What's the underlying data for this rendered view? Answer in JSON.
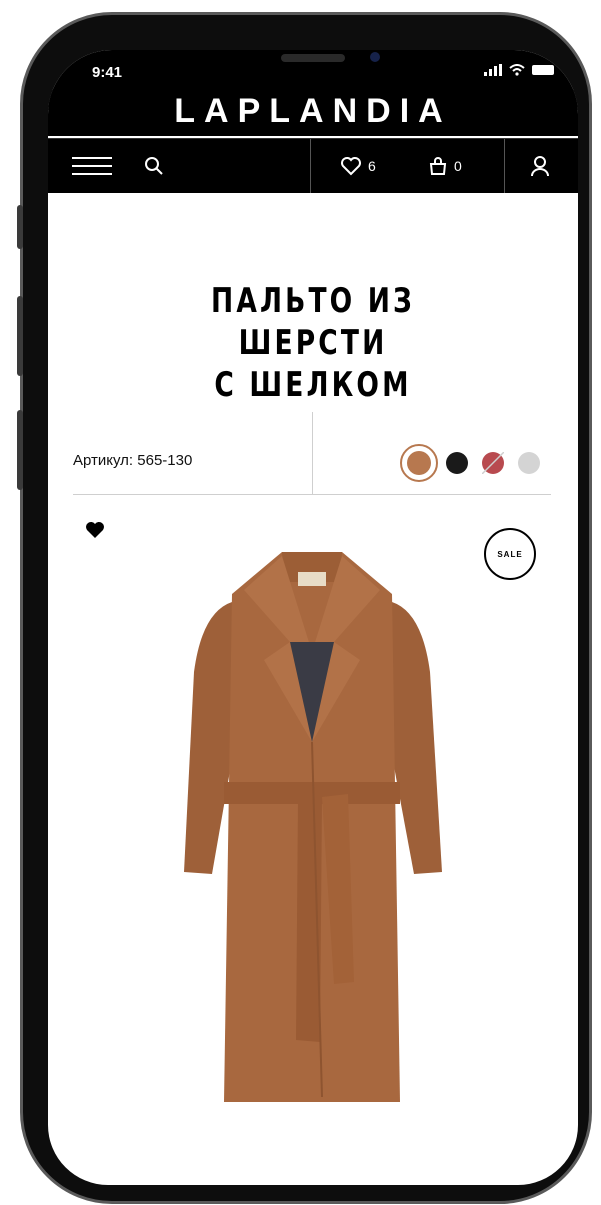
{
  "status_bar": {
    "time": "9:41"
  },
  "brand": {
    "name": "LAPLANDIA"
  },
  "nav": {
    "menu_icon": "hamburger-icon",
    "search_icon": "search-icon",
    "favorites_icon": "heart-outline-icon",
    "favorites_count": "6",
    "cart_icon": "bag-icon",
    "cart_count": "0",
    "account_icon": "user-icon"
  },
  "product": {
    "title": "ПАЛЬТО ИЗ ШЕРСТИ\nС ШЕЛКОМ",
    "sku": "Артикул: 565-130",
    "badge": "SALE",
    "wishlist_icon": "heart-filled-icon",
    "colors": [
      {
        "hex": "#b7784f",
        "selected": true,
        "available": true
      },
      {
        "hex": "#1a1a1a",
        "selected": false,
        "available": true
      },
      {
        "hex": "#b84a4f",
        "selected": false,
        "available": false
      },
      {
        "hex": "#d4d4d4",
        "selected": false,
        "available": true
      }
    ]
  },
  "colors": {
    "bar_background": "#000000",
    "page_background": "#ffffff",
    "coat": "#a8683f"
  }
}
